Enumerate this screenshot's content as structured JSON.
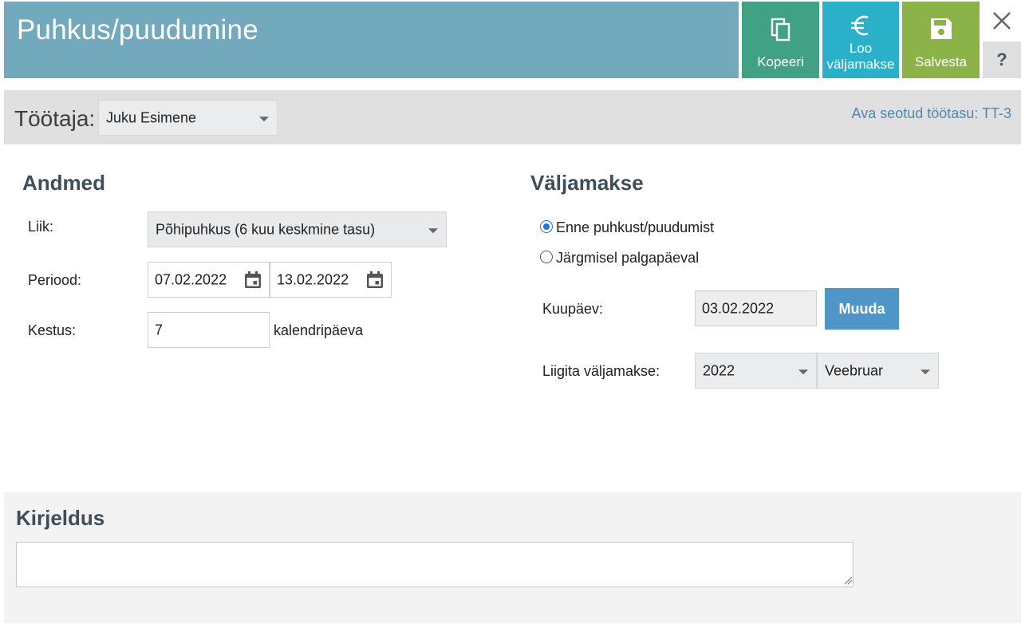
{
  "header": {
    "title": "Puhkus/puudumine",
    "buttons": {
      "copy": "Kopeeri",
      "payout_line1": "Loo",
      "payout_line2": "väljamakse",
      "save": "Salvesta"
    },
    "help": "?",
    "icons": [
      "copy-icon",
      "euro-icon",
      "save-icon",
      "close-icon"
    ]
  },
  "employee": {
    "label": "Töötaja:",
    "selected": "Juku Esimene",
    "related_link": "Ava seotud töötasu: TT-3"
  },
  "data_section": {
    "title": "Andmed",
    "type_label": "Liik:",
    "type_value": "Põhipuhkus (6 kuu keskmine tasu)",
    "period_label": "Periood:",
    "period_start": "07.02.2022",
    "period_end": "13.02.2022",
    "duration_label": "Kestus:",
    "duration_value": "7",
    "duration_unit": "kalendripäeva"
  },
  "payout_section": {
    "title": "Väljamakse",
    "options": [
      {
        "label": "Enne puhkust/puudumist",
        "selected": true
      },
      {
        "label": "Järgmisel palgapäeval",
        "selected": false
      }
    ],
    "date_label": "Kuupäev:",
    "date_value": "03.02.2022",
    "change_button": "Muuda",
    "assign_label": "Liigita väljamakse:",
    "year": "2022",
    "month": "Veebruar"
  },
  "description": {
    "title": "Kirjeldus",
    "value": ""
  },
  "colors": {
    "header_bg": "#73a9bd",
    "copy_btn": "#41a283",
    "payout_btn": "#2ab0c8",
    "save_btn": "#8cb347",
    "change_btn": "#4f96c8",
    "link": "#4f88b0"
  }
}
